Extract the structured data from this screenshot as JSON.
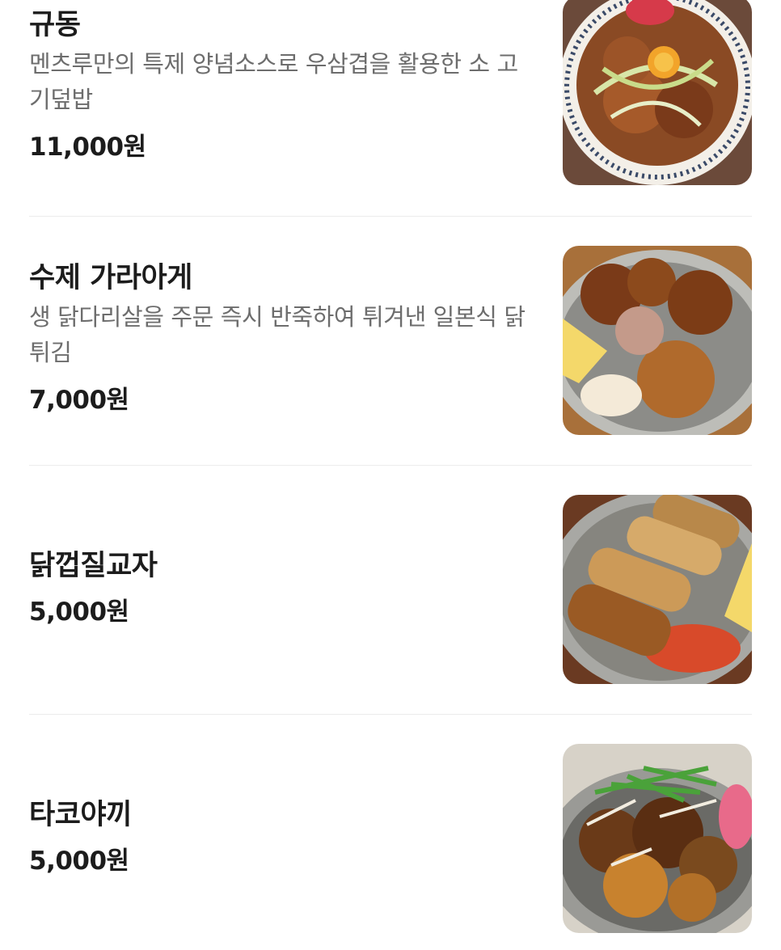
{
  "menu": {
    "items": [
      {
        "name": "규동",
        "description": "멘츠루만의 특제 양념소스로 우삼겹을 활용한 소 고기덮밥",
        "price": "11,000원",
        "image_icon": "gyudon-bowl-image"
      },
      {
        "name": "수제 가라아게",
        "description": "생 닭다리살을 주문 즉시 반죽하여 튀겨낸 일본식 닭 튀김",
        "price": "7,000원",
        "image_icon": "karaage-plate-image"
      },
      {
        "name": "닭껍질교자",
        "price": "5,000원",
        "image_icon": "chicken-skin-gyoza-image"
      },
      {
        "name": "타코야끼",
        "price": "5,000원",
        "image_icon": "takoyaki-plate-image"
      }
    ]
  }
}
